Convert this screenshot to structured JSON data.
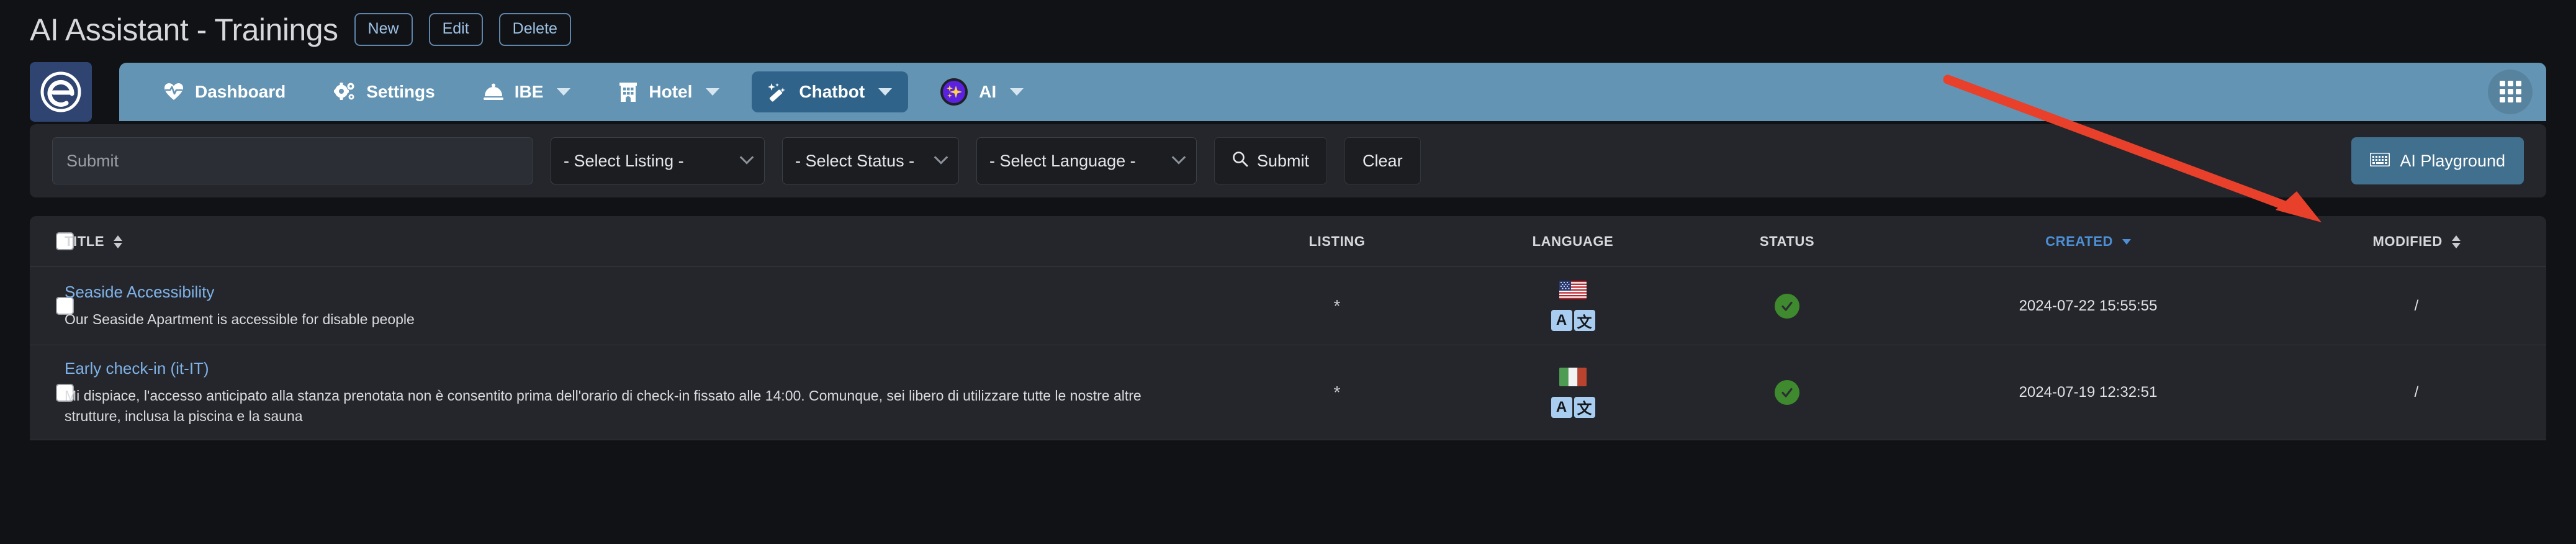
{
  "header": {
    "title": "AI Assistant - Trainings",
    "buttons": [
      {
        "label": "New",
        "name": "new-button"
      },
      {
        "label": "Edit",
        "name": "edit-button"
      },
      {
        "label": "Delete",
        "name": "delete-button"
      }
    ]
  },
  "nav": {
    "logo_alt": "e-logo",
    "items": [
      {
        "label": "Dashboard",
        "icon": "heartbeat-icon",
        "caret": false,
        "active": false
      },
      {
        "label": "Settings",
        "icon": "gears-icon",
        "caret": false,
        "active": false
      },
      {
        "label": "IBE",
        "icon": "bell-icon",
        "caret": true,
        "active": false
      },
      {
        "label": "Hotel",
        "icon": "hotel-icon",
        "caret": true,
        "active": false
      },
      {
        "label": "Chatbot",
        "icon": "magic-wand-icon",
        "caret": true,
        "active": true
      },
      {
        "label": "AI",
        "icon": "ai-sparkle-icon",
        "caret": true,
        "active": false
      }
    ],
    "grid_button": "apps-grid-icon",
    "bar_color": "#6394b4",
    "active_color": "#2f6389"
  },
  "filters": {
    "search_placeholder": "Submit",
    "search_value": "",
    "listing_select": "- Select Listing -",
    "status_select": "- Select Status -",
    "language_select": "- Select Language -",
    "submit_label": "Submit",
    "clear_label": "Clear",
    "playground_label": "AI Playground",
    "playground_color": "#41708f"
  },
  "table": {
    "columns": [
      {
        "label": "TITLE",
        "sortable": true,
        "sorted": false,
        "name": "column-title"
      },
      {
        "label": "LISTING",
        "sortable": false,
        "sorted": false,
        "name": "column-listing"
      },
      {
        "label": "LANGUAGE",
        "sortable": false,
        "sorted": false,
        "name": "column-language"
      },
      {
        "label": "STATUS",
        "sortable": false,
        "sorted": false,
        "name": "column-status"
      },
      {
        "label": "CREATED",
        "sortable": true,
        "sorted": true,
        "name": "column-created"
      },
      {
        "label": "MODIFIED",
        "sortable": true,
        "sorted": false,
        "name": "column-modified"
      }
    ],
    "rows": [
      {
        "title": "Seaside Accessibility",
        "description": "Our Seaside Apartment is accessible for disable people",
        "listing": "*",
        "flag": "us",
        "translate_badge": [
          "A",
          "文"
        ],
        "status": "active",
        "created": "2024-07-22 15:55:55",
        "modified": "/"
      },
      {
        "title": "Early check-in (it-IT)",
        "description": "Mi dispiace, l'accesso anticipato alla stanza prenotata non è consentito prima dell'orario di check-in fissato alle 14:00. Comunque, sei libero di utilizzare tutte le nostre altre strutture, inclusa la piscina e la sauna",
        "listing": "*",
        "flag": "it",
        "translate_badge": [
          "A",
          "文"
        ],
        "status": "active",
        "created": "2024-07-19 12:32:51",
        "modified": "/"
      }
    ]
  },
  "annotation": {
    "arrow_color": "#e8402a",
    "name": "red-arrow-annotation"
  }
}
